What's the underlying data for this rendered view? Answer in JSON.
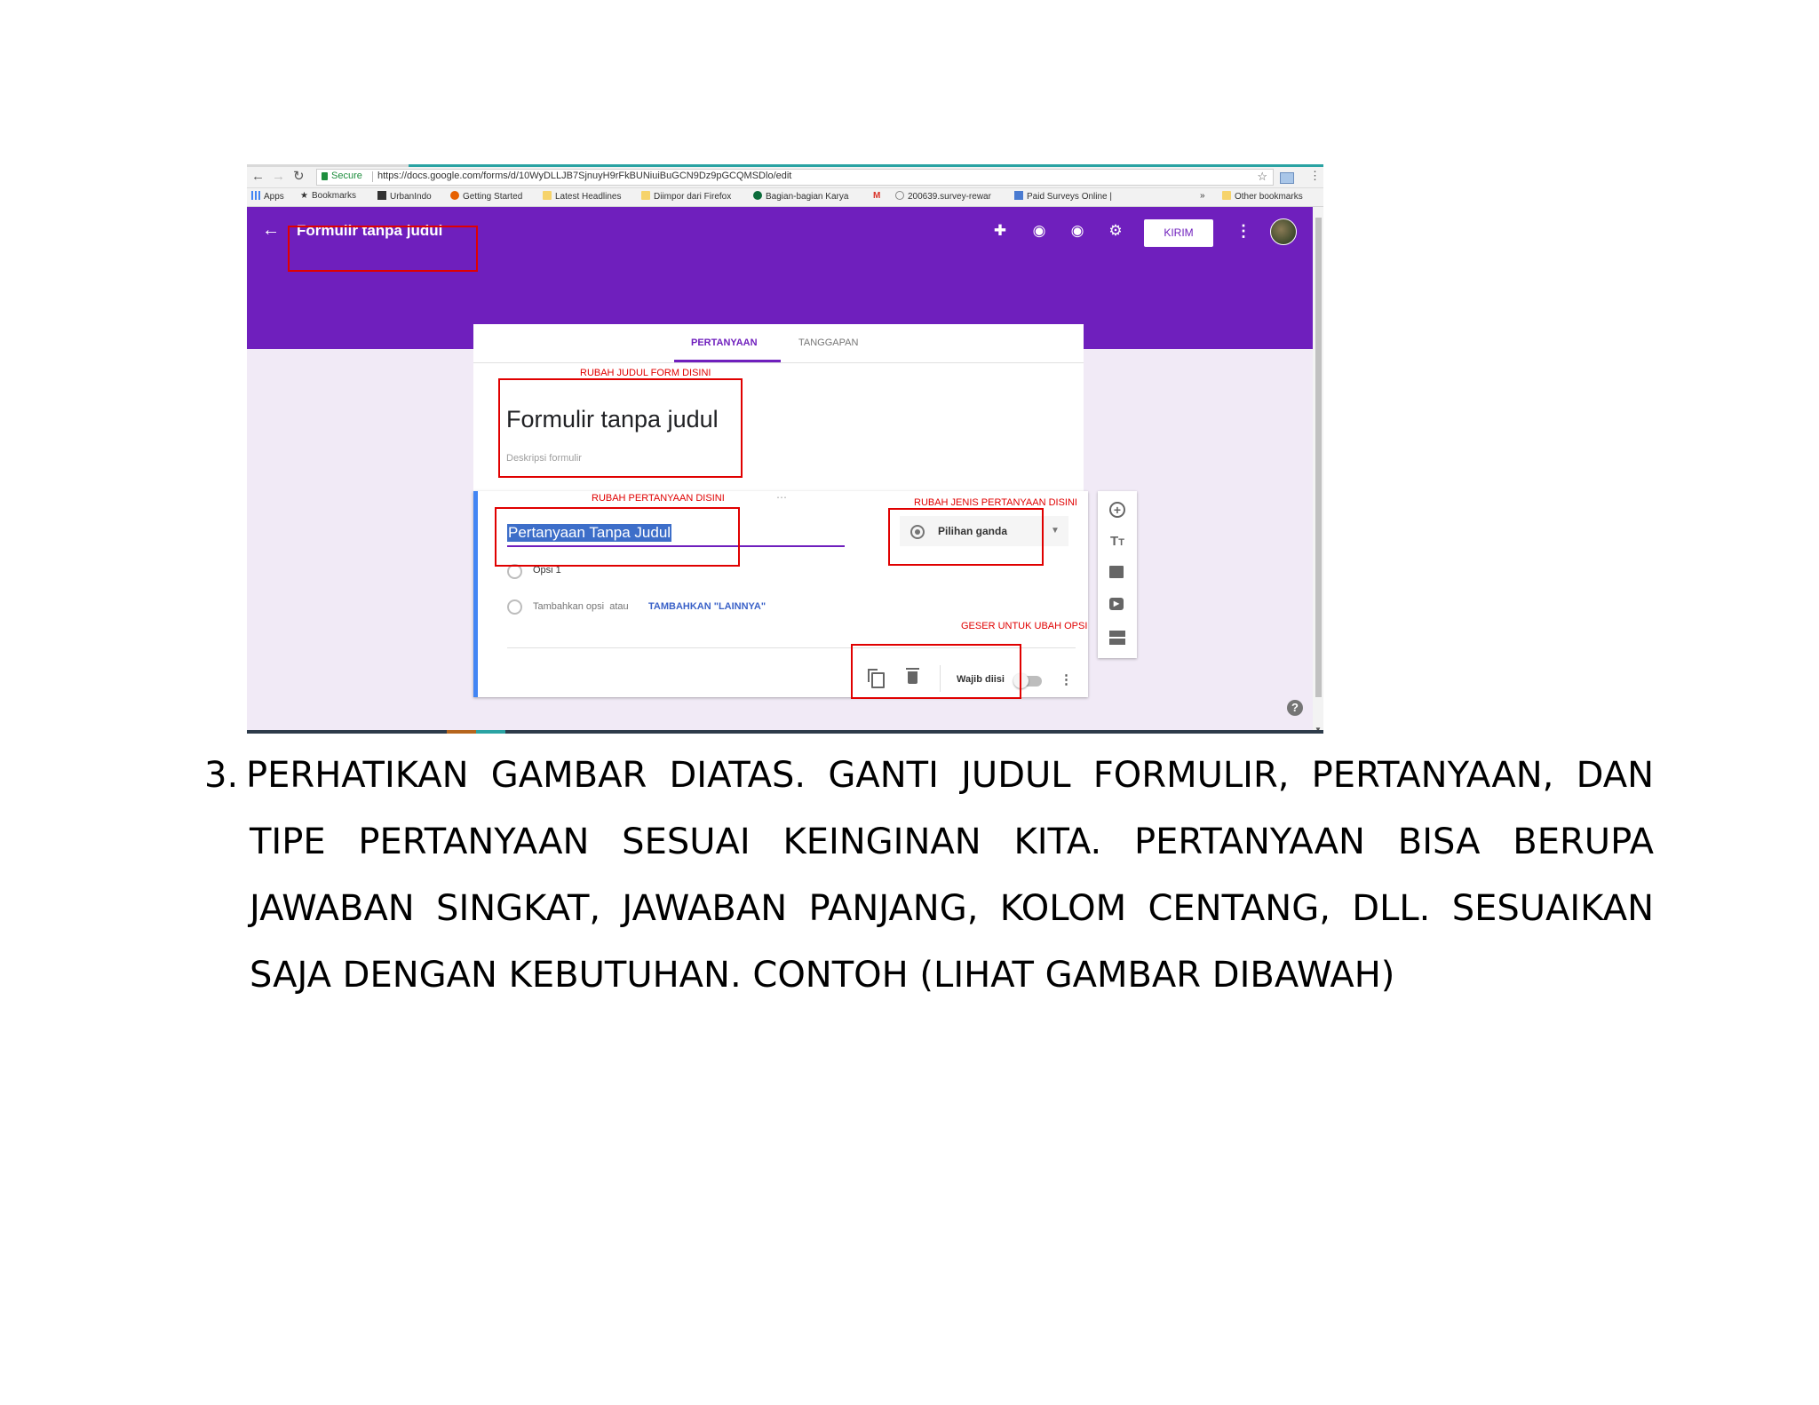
{
  "browser": {
    "secure_label": "Secure",
    "url": "https://docs.google.com/forms/d/10WyDLLJB7SjnuyH9rFkBUNiuiBuGCN9Dz9pGCQMSDlo/edit",
    "bookmarks": [
      "Apps",
      "Bookmarks",
      "UrbanIndo",
      "Getting Started",
      "Latest Headlines",
      "Diimpor dari Firefox",
      "Bagian-bagian Karya",
      "200639.survey-rewar",
      "Paid Surveys Online |",
      "»",
      "Other bookmarks"
    ]
  },
  "app": {
    "title": "Formulir tanpa judul",
    "send_label": "KIRIM",
    "accent_color": "#6f1fbd"
  },
  "tabs": {
    "questions": "PERTANYAAN",
    "responses": "TANGGAPAN"
  },
  "form": {
    "title": "Formulir tanpa judul",
    "description_placeholder": "Deskripsi formulir"
  },
  "question": {
    "text": "Pertanyaan Tanpa Judul",
    "type": "Pilihan ganda",
    "option1": "Opsi 1",
    "add_option": "Tambahkan opsi",
    "or": "atau",
    "add_other": "TAMBAHKAN \"LAINNYA\"",
    "required_label": "Wajib diisi",
    "required_on": false
  },
  "annotations": {
    "title_note": "RUBAH JUDUL FORM DISINI",
    "question_note": "RUBAH PERTANYAAN DISINI",
    "type_note": "RUBAH JENIS PERTANYAAN DISINI",
    "options_note": "GESER UNTUK UBAH OPSI",
    "color": "#e00000"
  },
  "instruction": {
    "number": "3.",
    "text": "PERHATIKAN GAMBAR DIATAS. GANTI JUDUL FORMULIR, PERTANYAAN, DAN TIPE PERTANYAAN SESUAI KEINGINAN KITA. PERTANYAAN BISA BERUPA JAWABAN SINGKAT, JAWABAN PANJANG, KOLOM CENTANG, DLL. SESUAIKAN SAJA DENGAN KEBUTUHAN. CONTOH (LIHAT GAMBAR DIBAWAH)"
  }
}
